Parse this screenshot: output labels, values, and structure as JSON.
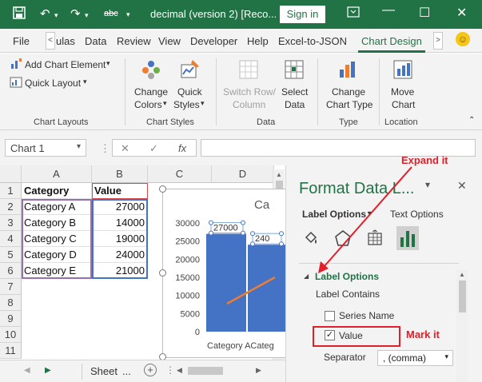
{
  "titlebar": {
    "doc_title": "decimal (version 2) [Reco...",
    "sign_in": "Sign in",
    "save_icon": "save-icon",
    "undo_icon": "undo-icon",
    "redo_icon": "redo-icon",
    "format_painter_icon": "abc-icon",
    "minimize": "—",
    "maximize": "☐",
    "close": "✕"
  },
  "tabs": [
    "File",
    "ulas",
    "Data",
    "Review",
    "View",
    "Developer",
    "Help",
    "Excel-to-JSON",
    "Chart Design"
  ],
  "tab_scroll_left": "<",
  "tab_scroll_right": ">",
  "ribbon": {
    "add_chart_element": "Add Chart Element",
    "quick_layout": "Quick Layout",
    "change_colors": [
      "Change",
      "Colors"
    ],
    "quick_styles": [
      "Quick",
      "Styles"
    ],
    "switch_row_col": [
      "Switch Row/",
      "Column"
    ],
    "select_data": [
      "Select",
      "Data"
    ],
    "change_chart_type": [
      "Change",
      "Chart Type"
    ],
    "move_chart": [
      "Move",
      "Chart"
    ],
    "groups": [
      "Chart Layouts",
      "Chart Styles",
      "Data",
      "Type",
      "Location"
    ]
  },
  "formula_bar": {
    "name_box": "Chart 1",
    "cancel": "✕",
    "enter": "✓",
    "fx": "fx",
    "formula": ""
  },
  "sheet": {
    "columns": [
      "A",
      "B",
      "C",
      "D"
    ],
    "rows": [
      "1",
      "2",
      "3",
      "4",
      "5",
      "6",
      "7",
      "8",
      "9",
      "10",
      "11"
    ],
    "header": [
      "Category",
      "Value"
    ],
    "data": [
      [
        "Category A",
        "27000"
      ],
      [
        "Category B",
        "14000"
      ],
      [
        "Category C",
        "19000"
      ],
      [
        "Category D",
        "24000"
      ],
      [
        "Category E",
        "21000"
      ]
    ],
    "tab_name": "Sheet",
    "tab_ellipsis": "..."
  },
  "chart": {
    "title_fragment": "Ca",
    "label_1": "27000",
    "label_2": "240",
    "x_text": "Category ACateg"
  },
  "chart_data": {
    "type": "bar",
    "categories": [
      "Category A",
      "Category B"
    ],
    "values": [
      27000,
      24000
    ],
    "title": "Ca",
    "xlabel": "",
    "ylabel": "",
    "ylim": [
      0,
      30000
    ],
    "yticks": [
      0,
      5000,
      10000,
      15000,
      20000,
      25000,
      30000
    ],
    "data_labels": [
      "27000",
      "240"
    ],
    "bar_color": "#4472c4",
    "line_color": "#ed7d31",
    "grid": false
  },
  "pane": {
    "title": "Format Data L...",
    "label_options_tab": "Label Options",
    "text_options_tab": "Text Options",
    "section": "Label Options",
    "label_contains": "Label Contains",
    "series_name": "Series Name",
    "series_name_checked": false,
    "value": "Value",
    "value_checked": true,
    "separator_label": "Separator",
    "separator_value": ", (comma)",
    "close": "✕",
    "menu_arrow": "▾"
  },
  "annotations": {
    "expand": "Expand it",
    "mark": "Mark it",
    "color": "#e0202a"
  },
  "colors": {
    "accent": "#217346",
    "bar": "#4472c4",
    "line": "#ed7d31"
  }
}
